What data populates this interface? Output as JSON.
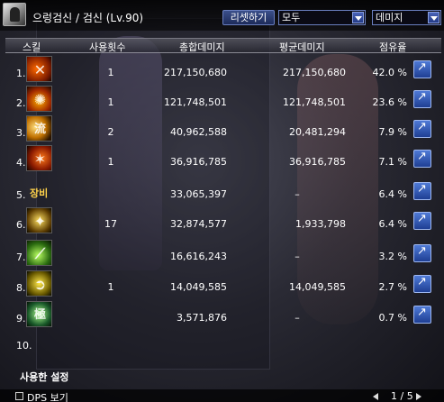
{
  "character": {
    "name_level": "으렁검신 / 검신 (Lv.90)"
  },
  "toolbar": {
    "reset_label": "리셋하기",
    "filter_value": "모두",
    "metric_value": "데미지"
  },
  "header": {
    "skill": "스킬",
    "uses": "사용횟수",
    "total_damage": "총합데미지",
    "avg_damage": "평균데미지",
    "share": "점유율"
  },
  "rows": [
    {
      "rank": "1.",
      "icon": "flame-slash-skill-icon",
      "uses": "1",
      "total": "217,150,680",
      "avg": "217,150,680",
      "share": "42.0 %"
    },
    {
      "rank": "2.",
      "icon": "fire-burst-skill-icon",
      "uses": "1",
      "total": "121,748,501",
      "avg": "121,748,501",
      "share": "23.6 %"
    },
    {
      "rank": "3.",
      "icon": "ryu-crescent-skill-icon",
      "uses": "2",
      "total": "40,962,588",
      "avg": "20,481,294",
      "share": "7.9 %"
    },
    {
      "rank": "4.",
      "icon": "blade-strike-skill-icon",
      "uses": "1",
      "total": "36,916,785",
      "avg": "36,916,785",
      "share": "7.1 %"
    },
    {
      "rank": "5.",
      "label": "장비",
      "uses": "",
      "total": "33,065,397",
      "avg": "–",
      "share": "6.4 %"
    },
    {
      "rank": "6.",
      "icon": "sword-dance-skill-icon",
      "uses": "17",
      "total": "32,874,577",
      "avg": "1,933,798",
      "share": "6.4 %"
    },
    {
      "rank": "7.",
      "icon": "green-slash-skill-icon",
      "uses": "",
      "total": "16,616,243",
      "avg": "–",
      "share": "3.2 %"
    },
    {
      "rank": "8.",
      "icon": "spiral-blade-skill-icon",
      "uses": "1",
      "total": "14,049,585",
      "avg": "14,049,585",
      "share": "2.7 %"
    },
    {
      "rank": "9.",
      "icon": "kanji-skill-icon",
      "uses": "",
      "total": "3,571,876",
      "avg": "–",
      "share": "0.7 %"
    }
  ],
  "row10_rank": "10.",
  "footer": {
    "used_settings": "사용한 설정",
    "dps_view": "DPS 보기",
    "page": "1 / 5"
  }
}
